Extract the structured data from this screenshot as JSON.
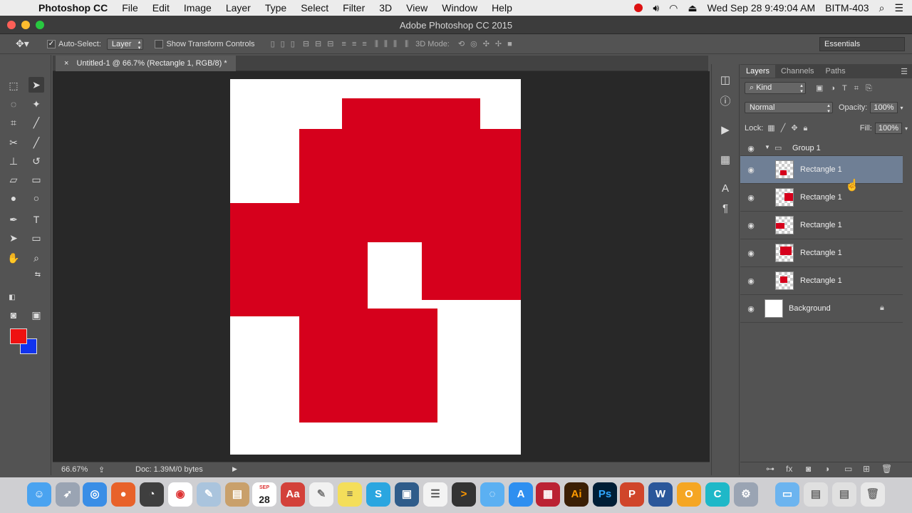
{
  "menubar": {
    "app_name": "Photoshop CC",
    "items": [
      "File",
      "Edit",
      "Image",
      "Layer",
      "Type",
      "Select",
      "Filter",
      "3D",
      "View",
      "Window",
      "Help"
    ],
    "clock": "Wed Sep 28  9:49:04 AM",
    "user": "BITM-403"
  },
  "window": {
    "title": "Adobe Photoshop CC 2015"
  },
  "options_bar": {
    "auto_select_label": "Auto-Select:",
    "auto_select_value": "Layer",
    "transform_label": "Show Transform Controls",
    "mode_3d_label": "3D Mode:",
    "workspace": "Essentials"
  },
  "document": {
    "tab_title": "Untitled-1 @ 66.7% (Rectangle 1, RGB/8) *",
    "zoom": "66.67%",
    "doc_info": "Doc: 1.39M/0 bytes"
  },
  "colors": {
    "foreground": "#ee1111",
    "background": "#1133ee",
    "shape_fill": "#d6001c"
  },
  "layers_panel": {
    "tabs": [
      "Layers",
      "Channels",
      "Paths"
    ],
    "filter": "Kind",
    "blend_mode": "Normal",
    "opacity_label": "Opacity:",
    "opacity": "100%",
    "lock_label": "Lock:",
    "fill_label": "Fill:",
    "fill": "100%",
    "group_name": "Group 1",
    "layers": [
      {
        "name": "Rectangle 1",
        "selected": true
      },
      {
        "name": "Rectangle 1",
        "selected": false
      },
      {
        "name": "Rectangle 1",
        "selected": false
      },
      {
        "name": "Rectangle 1",
        "selected": false
      },
      {
        "name": "Rectangle 1",
        "selected": false
      }
    ],
    "background_layer": "Background"
  },
  "dock": {
    "calendar_month": "SEP",
    "calendar_day": "28"
  }
}
